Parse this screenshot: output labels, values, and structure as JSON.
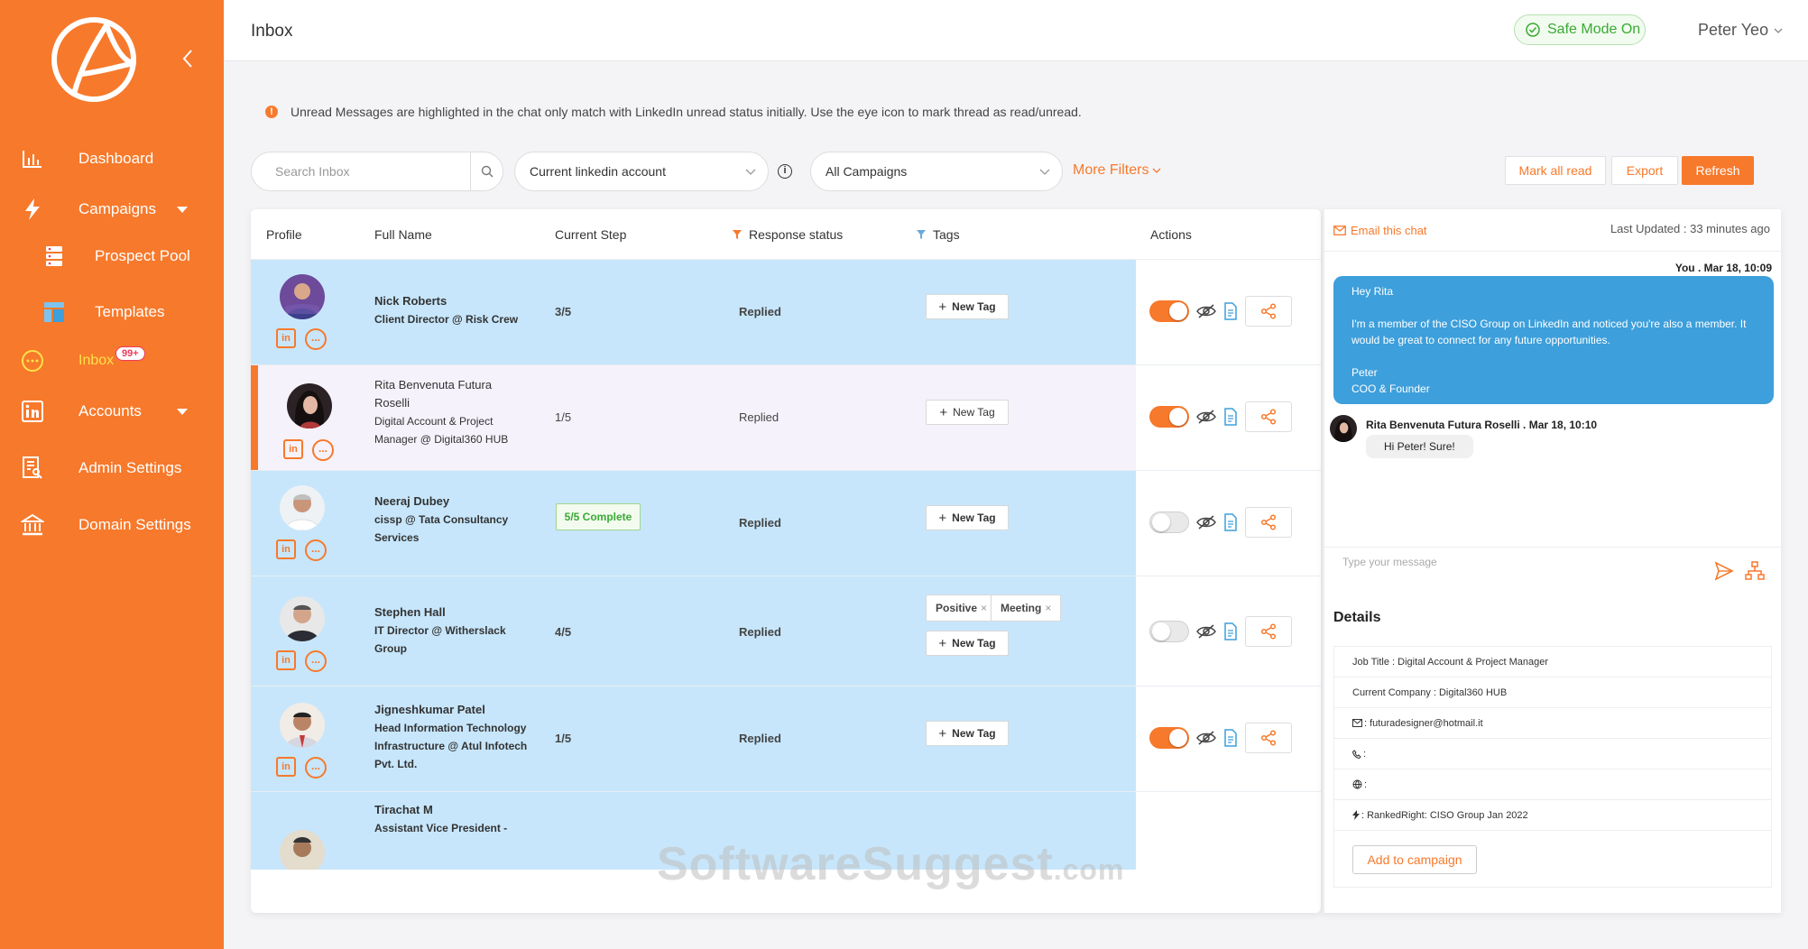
{
  "sidebar": {
    "items": [
      {
        "label": "Dashboard",
        "icon": "bar-chart-icon"
      },
      {
        "label": "Campaigns",
        "icon": "lightning-icon"
      },
      {
        "label": "Prospect Pool",
        "icon": "database-icon"
      },
      {
        "label": "Templates",
        "icon": "layout-icon"
      },
      {
        "label": "Inbox",
        "icon": "chat-bubble-icon",
        "badge": "99+"
      },
      {
        "label": "Accounts",
        "icon": "linkedin-icon"
      },
      {
        "label": "Admin Settings",
        "icon": "admin-icon"
      },
      {
        "label": "Domain Settings",
        "icon": "bank-icon"
      }
    ]
  },
  "header": {
    "title": "Inbox",
    "safe_mode": "Safe Mode On",
    "user": "Peter Yeo"
  },
  "notice": "Unread Messages are highlighted in the chat only match with LinkedIn unread status initially. Use the eye icon to mark thread as read/unread.",
  "filters": {
    "search_placeholder": "Search Inbox",
    "account_select": "Current linkedin account",
    "campaign_select": "All Campaigns",
    "more_filters": "More Filters",
    "mark_all_read": "Mark all read",
    "export": "Export",
    "refresh": "Refresh"
  },
  "table": {
    "columns": [
      "Profile",
      "Full Name",
      "Current Step",
      "Response status",
      "Tags",
      "Actions"
    ],
    "new_tag_label": "New Tag",
    "rows": [
      {
        "name": "Nick Roberts",
        "title": "Client Director @ Risk Crew",
        "step": "3/5",
        "response": "Replied",
        "tags": [],
        "auto_reply_on": true
      },
      {
        "name": "Rita Benvenuta Futura Roselli",
        "title": "Digital Account & Project Manager @ Digital360 HUB",
        "step": "1/5",
        "response": "Replied",
        "tags": [],
        "auto_reply_on": true
      },
      {
        "name": "Neeraj Dubey",
        "title": "cissp @ Tata Consultancy Services",
        "step": "5/5 Complete",
        "response": "Replied",
        "tags": [],
        "auto_reply_on": false
      },
      {
        "name": "Stephen Hall",
        "title": "IT Director @ Witherslack Group",
        "step": "4/5",
        "response": "Replied",
        "tags": [
          "Positive",
          "Meeting"
        ],
        "auto_reply_on": false
      },
      {
        "name": "Jigneshkumar Patel",
        "title": "Head Information Technology Infrastructure @ Atul Infotech Pvt. Ltd.",
        "step": "1/5",
        "response": "Replied",
        "tags": [],
        "auto_reply_on": true
      },
      {
        "name": "Tirachat M",
        "title": "Assistant Vice President -",
        "step": "",
        "response": "",
        "tags": [],
        "auto_reply_on": null
      }
    ]
  },
  "chat": {
    "email_this_chat": "Email this chat",
    "last_updated": "Last Updated : 33 minutes ago",
    "me_meta": "You . Mar 18, 10:09",
    "me_message": {
      "greeting": "Hey Rita",
      "body": "I'm a member of the CISO Group on LinkedIn and noticed you're also a member. It would be great to connect for any future opportunities.",
      "signoff_name": "Peter",
      "signoff_title": "COO & Founder"
    },
    "them_meta": "Rita Benvenuta Futura Roselli . Mar 18, 10:10",
    "them_message": "Hi Peter! Sure!",
    "input_placeholder": "Type your message"
  },
  "details": {
    "title": "Details",
    "job_title": "Job Title : Digital Account & Project Manager",
    "company": "Current Company : Digital360 HUB",
    "email": ": futuradesigner@hotmail.it",
    "phone": ":",
    "website": ":",
    "campaign": ": RankedRight: CISO Group Jan 2022",
    "add_to_campaign": "Add to campaign"
  },
  "watermark": {
    "main": "SoftwareSuggest",
    "suffix": ".com"
  },
  "colors": {
    "accent": "#f7792b",
    "row_highlight": "#c7e6fb",
    "chat_bubble": "#3d9fdb",
    "success": "#3aaa35"
  }
}
